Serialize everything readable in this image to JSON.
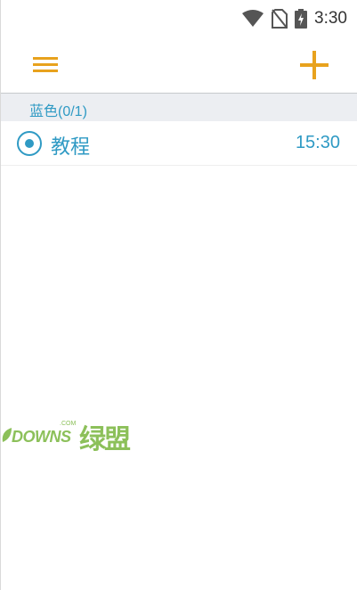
{
  "status_bar": {
    "time": "3:30",
    "icons": [
      "wifi-icon",
      "no-sim-icon",
      "battery-charging-icon"
    ]
  },
  "toolbar": {
    "menu_icon": "hamburger-menu-icon",
    "add_icon": "plus-icon",
    "accent_color": "#e8a21d"
  },
  "group": {
    "label": "蓝色(0/1)"
  },
  "items": [
    {
      "title": "教程",
      "time": "15:30",
      "color": "#2f9ac4"
    }
  ],
  "watermark": {
    "brand": "DOWNS",
    "suffix": ".COM",
    "chinese": "绿盟"
  }
}
